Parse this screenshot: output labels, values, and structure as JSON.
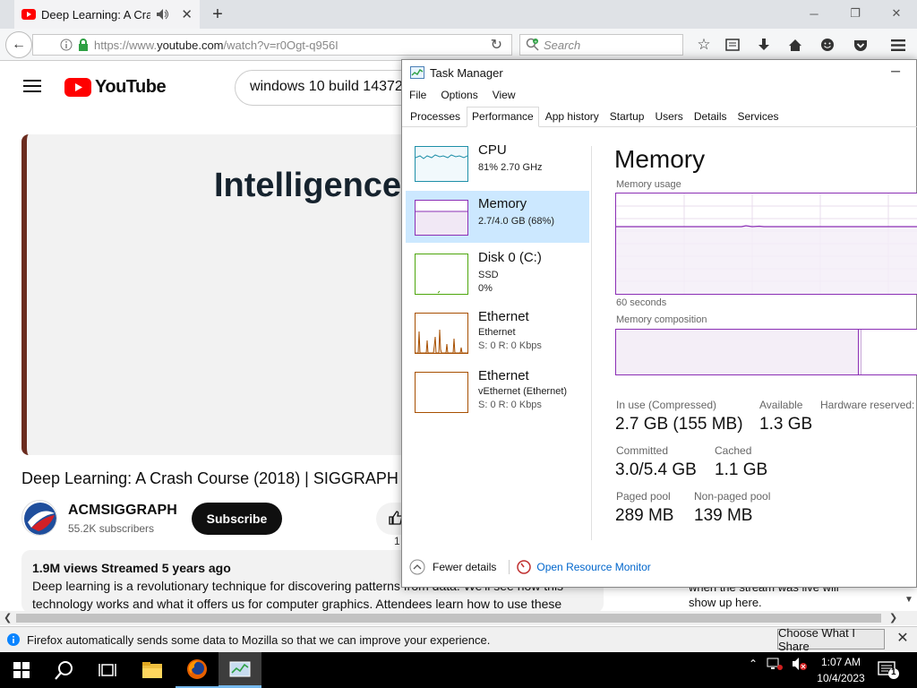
{
  "browser": {
    "tab_title": "Deep Learning: A Cras...",
    "url_prefix": "https://www.",
    "url_host": "youtube.com",
    "url_path": "/watch?v=r0Ogt-q956I",
    "search_placeholder": "Search",
    "new_tab": "+"
  },
  "youtube": {
    "logo_text": "YouTube",
    "search_value": "windows 10 build 14372",
    "video_overlay_text": "Intelligence",
    "video_title": "Deep Learning: A Crash Course (2018) | SIGGRAPH",
    "channel_name": "ACMSIGGRAPH",
    "subscribers": "55.2K subscribers",
    "subscribe_label": "Subscribe",
    "like_count": "1",
    "views_line": "1.9M views  Streamed 5 years ago",
    "description": "Deep learning is a revolutionary technique for discovering patterns from data. We'll see how this technology works and what it offers us for computer graphics. Attendees learn how to use these",
    "side_text_1": "when the stream was live will",
    "side_text_2": "show up here."
  },
  "notification": {
    "text": "Firefox automatically sends some data to Mozilla so that we can improve your experience.",
    "button": "Choose What I Share"
  },
  "taskmanager": {
    "title": "Task Manager",
    "menu": [
      "File",
      "Options",
      "View"
    ],
    "tabs": [
      "Processes",
      "Performance",
      "App history",
      "Startup",
      "Users",
      "Details",
      "Services"
    ],
    "active_tab": "Performance",
    "items": [
      {
        "name": "CPU",
        "sub1": "81%  2.70 GHz",
        "sub2": "",
        "sub3": ""
      },
      {
        "name": "Memory",
        "sub1": "2.7/4.0 GB (68%)",
        "sub2": "",
        "sub3": ""
      },
      {
        "name": "Disk 0 (C:)",
        "sub1": "SSD",
        "sub2": "0%",
        "sub3": ""
      },
      {
        "name": "Ethernet",
        "sub1": "Ethernet",
        "sub2": "S: 0  R: 0 Kbps",
        "sub3": ""
      },
      {
        "name": "Ethernet",
        "sub1": "vEthernet (Ethernet)",
        "sub2": "S: 0  R: 0 Kbps",
        "sub3": ""
      }
    ],
    "memory": {
      "title": "Memory",
      "usage_label": "Memory usage",
      "time_label": "60 seconds",
      "composition_label": "Memory composition",
      "in_use_label": "In use (Compressed)",
      "in_use_value": "2.7 GB (155 MB)",
      "available_label": "Available",
      "available_value": "1.3 GB",
      "hw_reserved_label": "Hardware reserved:",
      "committed_label": "Committed",
      "committed_value": "3.0/5.4 GB",
      "cached_label": "Cached",
      "cached_value": "1.1 GB",
      "paged_label": "Paged pool",
      "paged_value": "289 MB",
      "nonpaged_label": "Non-paged pool",
      "nonpaged_value": "139 MB"
    },
    "footer": {
      "fewer": "Fewer details",
      "resource_monitor": "Open Resource Monitor"
    }
  },
  "taskbar": {
    "time": "1:07 AM",
    "date": "10/4/2023",
    "notification_count": "1"
  },
  "colors": {
    "memory_purple": "#8b2fb5",
    "cpu_teal": "#1e8fa8",
    "disk_green": "#4da60c",
    "ethernet_brown": "#a74f01",
    "youtube_red": "#ff0000",
    "selection_blue": "#cce8ff"
  }
}
